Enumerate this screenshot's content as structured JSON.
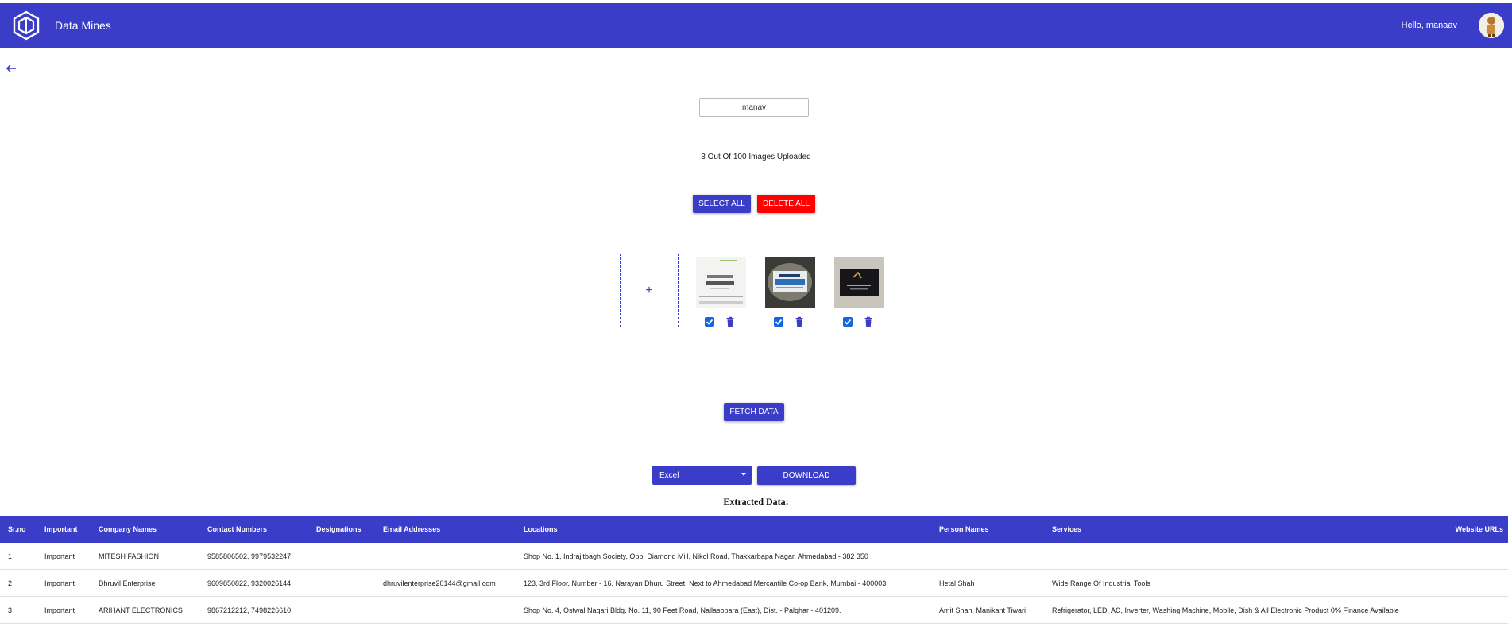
{
  "header": {
    "app_title": "Data Mines",
    "greeting": "Hello, manaav"
  },
  "colors": {
    "primary": "#3a3dc8",
    "danger": "#ff0000"
  },
  "name_field": {
    "value": "manav"
  },
  "status_text": "3 Out Of 100 Images Uploaded",
  "buttons": {
    "select_all": "SELECT ALL",
    "delete_all": "DELETE ALL",
    "fetch_data": "FETCH DATA",
    "download": "DOWNLOAD"
  },
  "upload": {
    "icon": "+"
  },
  "images": [
    {
      "name": "dhruvil-enterprise-card",
      "checked": true
    },
    {
      "name": "arihant-card",
      "checked": true
    },
    {
      "name": "mitesh-fashion-card",
      "checked": true
    }
  ],
  "format_select": {
    "value": "Excel"
  },
  "table": {
    "title": "Extracted Data:",
    "columns": [
      "Sr.no",
      "Important",
      "Company Names",
      "Contact Numbers",
      "Designations",
      "Email Addresses",
      "Locations",
      "Person Names",
      "Services",
      "Website URLs"
    ],
    "rows": [
      [
        "1",
        "Important",
        "MITESH FASHION",
        "9585806502, 9979532247",
        "",
        "",
        "Shop No. 1, Indrajitbagh Society, Opp. Diamond Mill, Nikol Road, Thakkarbapa Nagar, Ahmedabad - 382 350",
        "",
        "",
        ""
      ],
      [
        "2",
        "Important",
        "Dhruvil Enterprise",
        "9609850822, 9320026144",
        "",
        "dhruvilenterprise20144@gmail.com",
        "123, 3rd Floor, Number - 16, Narayan Dhuru Street, Next to Ahmedabad Mercantile Co-op Bank, Mumbai - 400003",
        "Hetal Shah",
        "Wide Range Of Industrial Tools",
        ""
      ],
      [
        "3",
        "Important",
        "ARIHANT ELECTRONICS",
        "9867212212, 7498226610",
        "",
        "",
        "Shop No. 4, Ostwal Nagari Bldg. No. 11, 90 Feet Road, Nallasopara (East), Dist. - Palghar - 401209.",
        "Amit Shah, Manikant Tiwari",
        "Refrigerator, LED, AC, Inverter, Washing Machine, Mobile, Dish & All Electronic Product 0% Finance Available",
        ""
      ]
    ]
  }
}
